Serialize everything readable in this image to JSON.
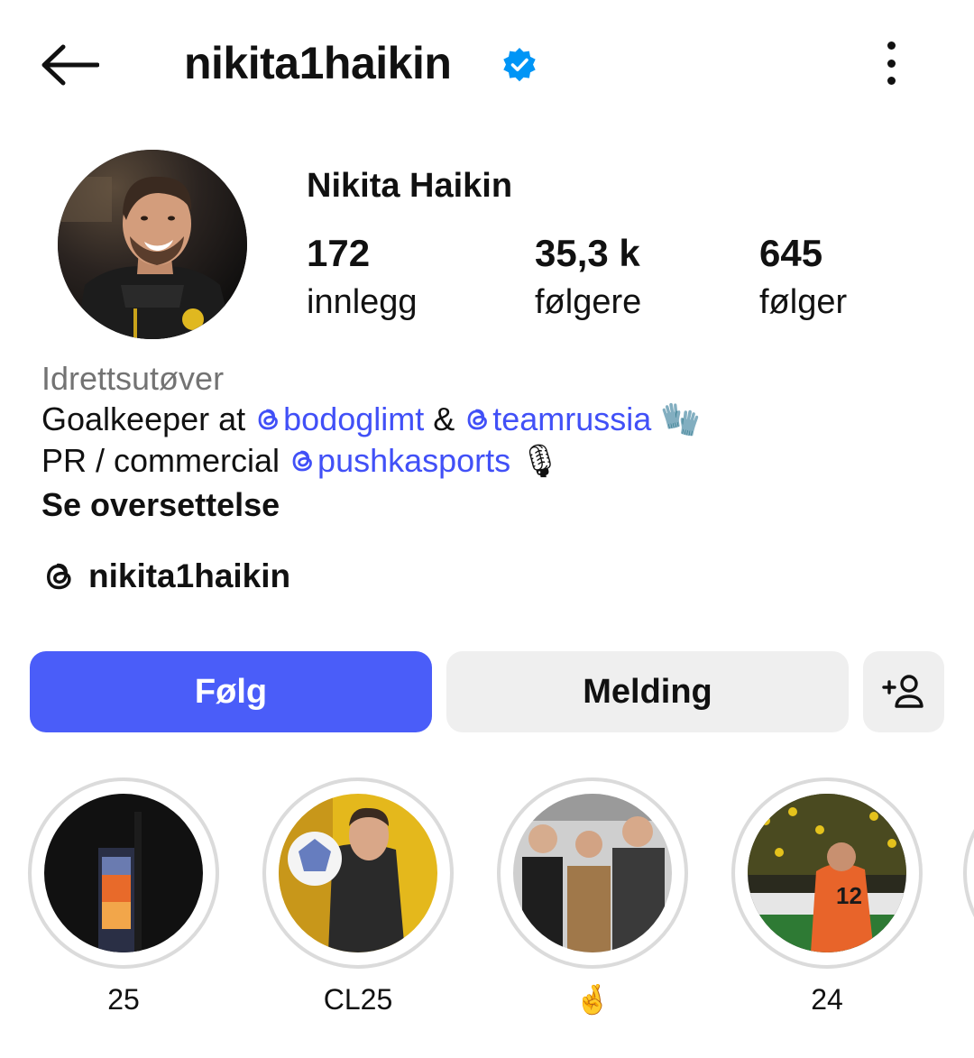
{
  "header": {
    "username": "nikita1haikin",
    "verified_icon": "verified-badge-icon",
    "back_icon": "arrow-left-icon",
    "more_icon": "more-vertical-icon"
  },
  "profile": {
    "full_name": "Nikita Haikin",
    "stats": [
      {
        "value": "172",
        "label": "innlegg"
      },
      {
        "value": "35,3 k",
        "label": "følgere"
      },
      {
        "value": "645",
        "label": "følger"
      }
    ]
  },
  "bio": {
    "category": "Idrettsutøver",
    "line1_prefix": "Goalkeeper at ",
    "mention1": "bodoglimt",
    "line1_mid": " & ",
    "mention2": "teamrussia",
    "line1_emoji": "🧤",
    "line2_prefix": "PR / commercial ",
    "mention3": "pushkasports",
    "line2_emoji": "🎙",
    "translate": "Se oversettelse"
  },
  "threads": {
    "handle": "nikita1haikin",
    "icon": "threads-icon"
  },
  "actions": {
    "follow": "Følg",
    "message": "Melding",
    "add_user_icon": "add-person-icon"
  },
  "highlights": [
    {
      "label": "25"
    },
    {
      "label": "CL25"
    },
    {
      "label": "🤞"
    },
    {
      "label": "24"
    }
  ],
  "colors": {
    "accent": "#4a5df9",
    "mention": "#4150f7",
    "verified": "#0095f6",
    "muted": "#737373"
  }
}
